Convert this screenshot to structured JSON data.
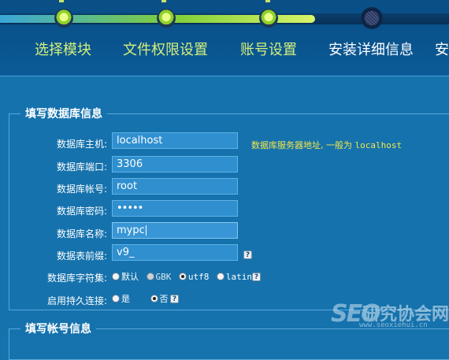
{
  "steps": [
    {
      "label": "选择模块",
      "state": "done"
    },
    {
      "label": "文件权限设置",
      "state": "done"
    },
    {
      "label": "账号设置",
      "state": "done"
    },
    {
      "label": "安装详细信息",
      "state": "current"
    },
    {
      "label": "安",
      "state": "upcoming"
    }
  ],
  "db_section": {
    "title": "填写数据库信息",
    "fields": [
      {
        "label": "数据库主机:",
        "value": "localhost"
      },
      {
        "label": "数据库端口:",
        "value": "3306"
      },
      {
        "label": "数据库帐号:",
        "value": "root"
      },
      {
        "label": "数据库密码:",
        "value": "•••••"
      },
      {
        "label": "数据库名称:",
        "value": "mypc"
      },
      {
        "label": "数据表前缀:",
        "value": "v9_"
      }
    ],
    "host_hint": "数据库服务器地址, 一般为",
    "host_hint_code": "localhost",
    "help_glyph": "?",
    "charset": {
      "label": "数据库字符集:",
      "options": [
        "默认",
        "GBK",
        "utf8",
        "latin1"
      ],
      "selected": "utf8"
    },
    "persistent": {
      "label": "启用持久连接:",
      "options": [
        "是",
        "否"
      ],
      "selected": "否"
    }
  },
  "account_section": {
    "title": "填写帐号信息"
  },
  "watermark": {
    "brand": "SEO",
    "name": "研究协会网",
    "url": "www.seoxiehui.cn"
  }
}
